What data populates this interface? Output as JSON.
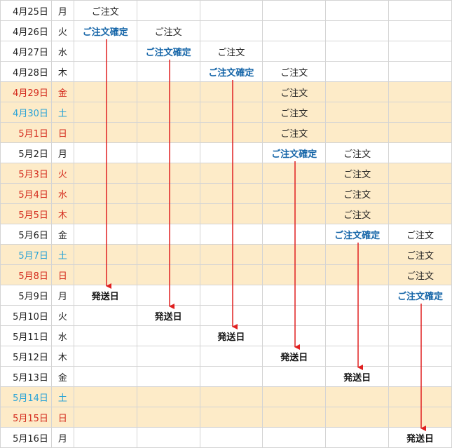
{
  "colors": {
    "holiday_bg": "#fdebc8",
    "sat": "#29a3d6",
    "sun": "#d42a1c",
    "weekday": "#222222",
    "confirm": "#1565a8",
    "arrow": "#e02020"
  },
  "rows": [
    {
      "date": "4月25日",
      "dow": "月",
      "kind": "weekday",
      "cells": [
        "ご注文",
        "",
        "",
        "",
        "",
        ""
      ]
    },
    {
      "date": "4月26日",
      "dow": "火",
      "kind": "weekday",
      "cells": [
        "ご注文確定",
        "ご注文",
        "",
        "",
        "",
        ""
      ]
    },
    {
      "date": "4月27日",
      "dow": "水",
      "kind": "weekday",
      "cells": [
        "",
        "ご注文確定",
        "ご注文",
        "",
        "",
        ""
      ]
    },
    {
      "date": "4月28日",
      "dow": "木",
      "kind": "weekday",
      "cells": [
        "",
        "",
        "ご注文確定",
        "ご注文",
        "",
        ""
      ]
    },
    {
      "date": "4月29日",
      "dow": "金",
      "kind": "holiday",
      "cells": [
        "",
        "",
        "",
        "ご注文",
        "",
        ""
      ]
    },
    {
      "date": "4月30日",
      "dow": "土",
      "kind": "sat",
      "cells": [
        "",
        "",
        "",
        "ご注文",
        "",
        ""
      ]
    },
    {
      "date": "5月1日",
      "dow": "日",
      "kind": "sun",
      "cells": [
        "",
        "",
        "",
        "ご注文",
        "",
        ""
      ]
    },
    {
      "date": "5月2日",
      "dow": "月",
      "kind": "weekday",
      "cells": [
        "",
        "",
        "",
        "ご注文確定",
        "ご注文",
        ""
      ]
    },
    {
      "date": "5月3日",
      "dow": "火",
      "kind": "holiday",
      "cells": [
        "",
        "",
        "",
        "",
        "ご注文",
        ""
      ]
    },
    {
      "date": "5月4日",
      "dow": "水",
      "kind": "holiday",
      "cells": [
        "",
        "",
        "",
        "",
        "ご注文",
        ""
      ]
    },
    {
      "date": "5月5日",
      "dow": "木",
      "kind": "holiday",
      "cells": [
        "",
        "",
        "",
        "",
        "ご注文",
        ""
      ]
    },
    {
      "date": "5月6日",
      "dow": "金",
      "kind": "weekday",
      "cells": [
        "",
        "",
        "",
        "",
        "ご注文確定",
        "ご注文"
      ]
    },
    {
      "date": "5月7日",
      "dow": "土",
      "kind": "sat",
      "cells": [
        "",
        "",
        "",
        "",
        "",
        "ご注文"
      ]
    },
    {
      "date": "5月8日",
      "dow": "日",
      "kind": "sun",
      "cells": [
        "",
        "",
        "",
        "",
        "",
        "ご注文"
      ]
    },
    {
      "date": "5月9日",
      "dow": "月",
      "kind": "weekday",
      "cells": [
        "発送日",
        "",
        "",
        "",
        "",
        "ご注文確定"
      ]
    },
    {
      "date": "5月10日",
      "dow": "火",
      "kind": "weekday",
      "cells": [
        "",
        "発送日",
        "",
        "",
        "",
        ""
      ]
    },
    {
      "date": "5月11日",
      "dow": "水",
      "kind": "weekday",
      "cells": [
        "",
        "",
        "発送日",
        "",
        "",
        ""
      ]
    },
    {
      "date": "5月12日",
      "dow": "木",
      "kind": "weekday",
      "cells": [
        "",
        "",
        "",
        "発送日",
        "",
        ""
      ]
    },
    {
      "date": "5月13日",
      "dow": "金",
      "kind": "weekday",
      "cells": [
        "",
        "",
        "",
        "",
        "発送日",
        ""
      ]
    },
    {
      "date": "5月14日",
      "dow": "土",
      "kind": "sat",
      "cells": [
        "",
        "",
        "",
        "",
        "",
        ""
      ]
    },
    {
      "date": "5月15日",
      "dow": "日",
      "kind": "sun",
      "cells": [
        "",
        "",
        "",
        "",
        "",
        ""
      ]
    },
    {
      "date": "5月16日",
      "dow": "月",
      "kind": "weekday",
      "cells": [
        "",
        "",
        "",
        "",
        "",
        "発送日"
      ]
    }
  ],
  "flows": [
    {
      "col": 0,
      "from_row": 1,
      "to_row": 14
    },
    {
      "col": 1,
      "from_row": 2,
      "to_row": 15
    },
    {
      "col": 2,
      "from_row": 3,
      "to_row": 16
    },
    {
      "col": 3,
      "from_row": 7,
      "to_row": 17
    },
    {
      "col": 4,
      "from_row": 11,
      "to_row": 18
    },
    {
      "col": 5,
      "from_row": 14,
      "to_row": 21
    }
  ],
  "labels": {
    "order": "ご注文",
    "confirm": "ご注文確定",
    "ship": "発送日"
  }
}
